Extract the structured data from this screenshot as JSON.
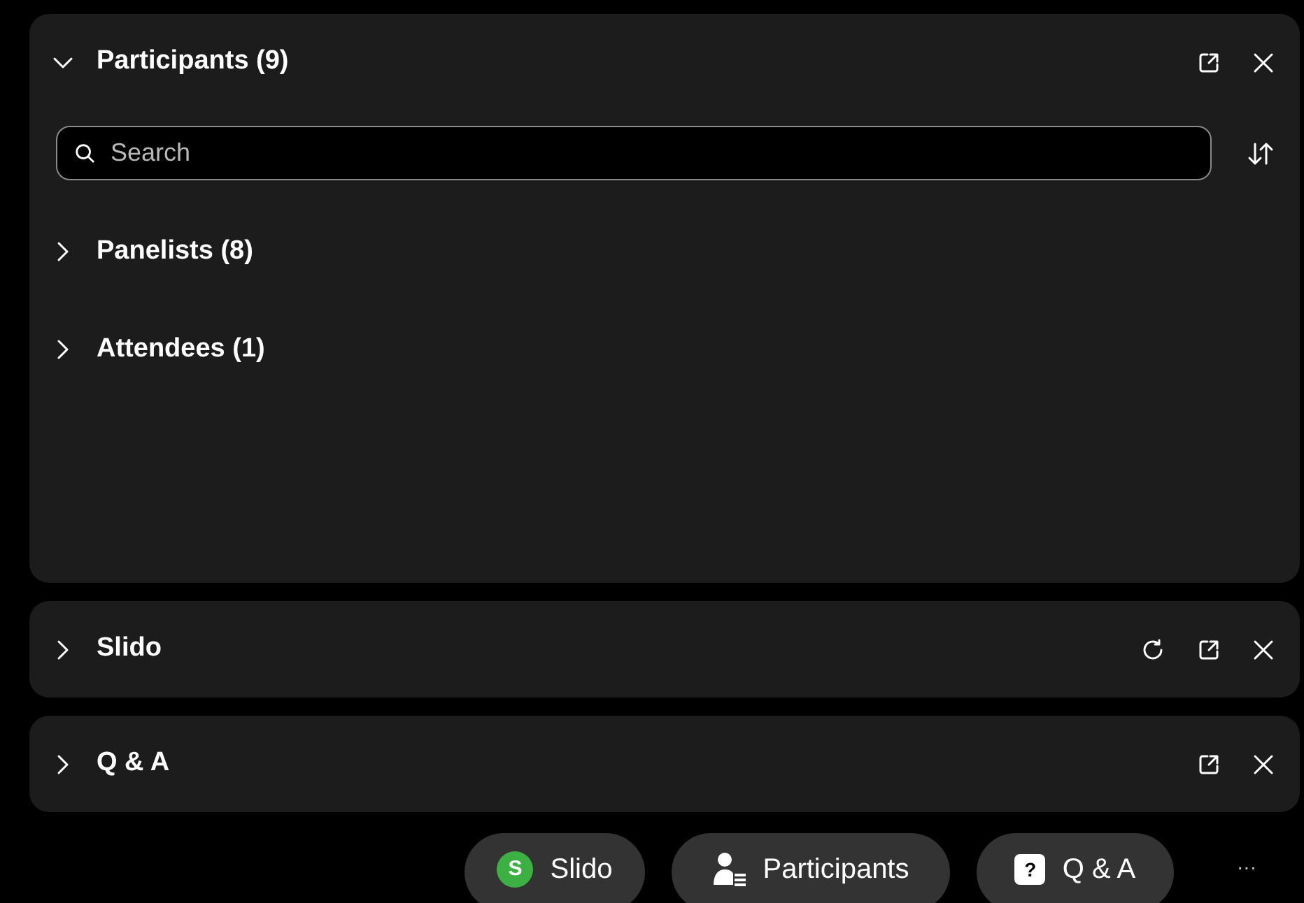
{
  "panels": [
    {
      "title": "Participants (9)",
      "expanded": true,
      "actions": [
        {
          "kind": "popout"
        },
        {
          "kind": "close"
        }
      ],
      "search": {
        "placeholder": "Search"
      },
      "groups": [
        {
          "label": "Panelists (8)",
          "expanded": false
        },
        {
          "label": "Attendees (1)",
          "expanded": false
        }
      ]
    },
    {
      "title": "Slido",
      "expanded": false,
      "actions": [
        {
          "kind": "refresh"
        },
        {
          "kind": "popout"
        },
        {
          "kind": "close"
        }
      ]
    },
    {
      "title": "Q & A",
      "expanded": false,
      "actions": [
        {
          "kind": "popout"
        },
        {
          "kind": "close"
        }
      ]
    }
  ],
  "toolbar": {
    "buttons": [
      {
        "kind": "slido",
        "label": "Slido",
        "glyph": "S"
      },
      {
        "kind": "participants",
        "label": "Participants"
      },
      {
        "kind": "qa",
        "label": "Q & A",
        "glyph": "?"
      }
    ],
    "more": "···"
  }
}
